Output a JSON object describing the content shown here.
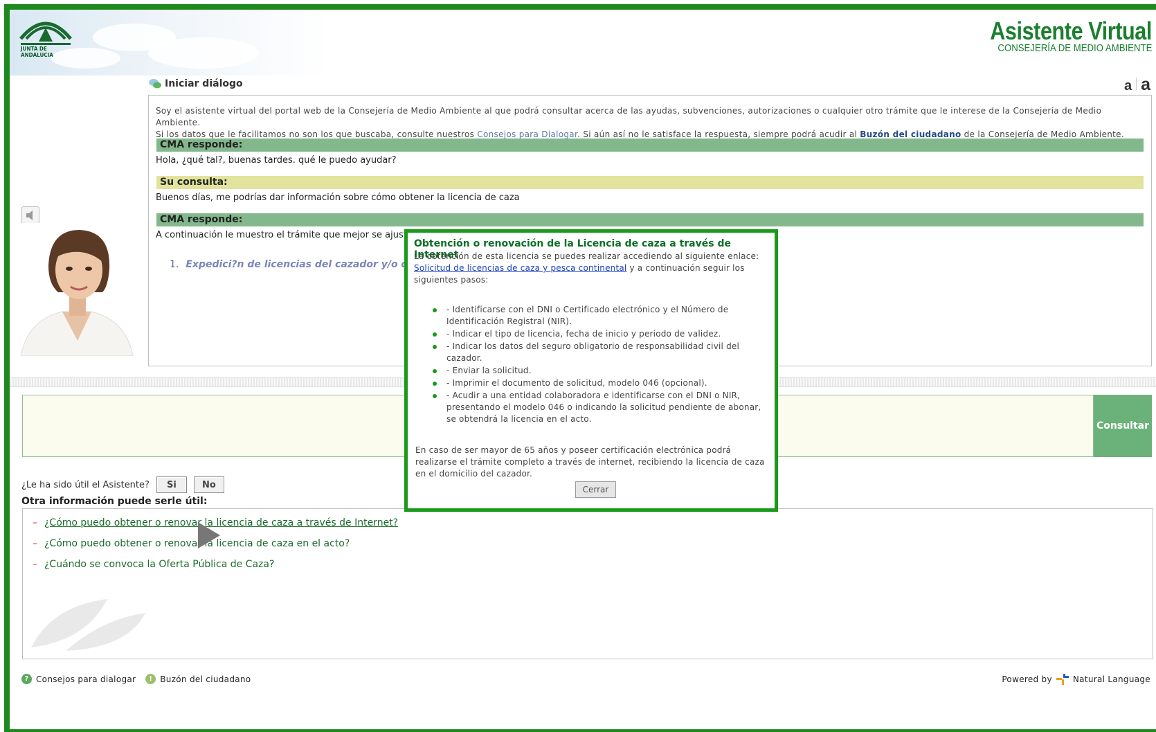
{
  "header": {
    "logo_text": "JUNTA DE ANDALUCIA",
    "brand_title": "Asistente Virtual",
    "brand_subtitle": "CONSEJERÍA DE MEDIO AMBIENTE"
  },
  "dialog": {
    "start_label": "Iniciar diálogo",
    "font_small": "a",
    "font_large": "a",
    "intro_line1": "Soy el asistente virtual del portal web de la Consejería de Medio Ambiente al que podrá consultar acerca de las ayudas, subvenciones, autorizaciones o cualquier otro trámite que le interese de la Consejería de Medio Ambiente.",
    "intro_line2_a": "Si los datos que le facilitamos no son los que buscaba, consulte nuestros ",
    "intro_link_consejos": "Consejos para Dialogar",
    "intro_line2_b": ". Si aún así no le satisface la respuesta, siempre podrá acudir al ",
    "intro_link_buzon": "Buzón del ciudadano",
    "intro_line2_c": " de la Consejería de Medio Ambiente.",
    "messages": [
      {
        "speaker": "CMA responde:",
        "text": "Hola, ¿qué tal?, buenas tardes. qué le puedo ayudar?"
      },
      {
        "speaker": "Su consulta:",
        "text": "Buenos días, me podrías dar información sobre cómo obtener la licencia de caza"
      },
      {
        "speaker": "CMA responde:",
        "text": "A continuación le muestro el trámite que mejor se ajusta a"
      }
    ],
    "result_number": "1.",
    "result_link": "Expedici?n de licencias del cazador y/o del"
  },
  "query": {
    "consultar_label": "Consultar"
  },
  "feedback": {
    "question": "¿Le ha sido útil el Asistente?",
    "yes_label": "Si",
    "no_label": "No"
  },
  "related": {
    "heading": "Otra información puede serle útil:",
    "items": [
      "¿Cómo puedo obtener o renovar la licencia de caza a través de Internet?",
      "¿Cómo puedo obtener o renovar la licencia de caza en el acto?",
      "¿Cuándo se convoca la Oferta Pública de Caza?"
    ]
  },
  "footer": {
    "consejos_label": "Consejos para dialogar",
    "buzon_label": "Buzón del ciudadano",
    "powered_by": "Powered by",
    "powered_brand": "Natural Language"
  },
  "popup": {
    "title": "Obtención o renovación de la Licencia de caza a través de Internet",
    "intro_line1": "La obtención de esta licencia se puedes realizar accediendo al siguiente enlace:",
    "link_text": "Solicitud de licencias de caza y pesca continental",
    "intro_rest": " y a continuación seguir los siguientes pasos:",
    "steps": [
      "- Identificarse con el DNI o Certificado electrónico y el Número de Identificación Registral (NIR).",
      "- Indicar el tipo de licencia, fecha de inicio y periodo de validez.",
      "- Indicar los datos del seguro obligatorio de responsabilidad civil del cazador.",
      "- Enviar la solicitud.",
      "- Imprimir el documento de solicitud, modelo 046 (opcional).",
      "- Acudir a una entidad colaboradora e identificarse con el DNI o NIR, presentando el modelo 046 o indicando la solicitud pendiente de abonar, se obtendrá la licencia en el acto."
    ],
    "note": "En caso de ser mayor de 65 años y poseer certificación electrónica podrá realizarse el trámite completo a través de internet, recibiendo la licencia de caza en el domicilio del cazador.",
    "close_label": "Cerrar"
  },
  "colors": {
    "frame": "#1e8a1e",
    "cma_bar": "#83b88c",
    "user_bar": "#e2e39c",
    "consultar": "#6bb27a",
    "popup_border": "#1a9a1a",
    "brand": "#1a7f2e"
  }
}
